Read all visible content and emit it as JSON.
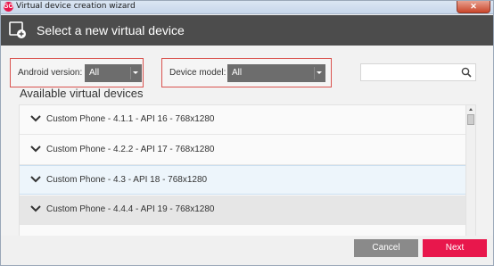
{
  "window": {
    "title": "Virtual device creation wizard",
    "close_label": "✕"
  },
  "header": {
    "title": "Select a new virtual device",
    "icon": "add-device-icon"
  },
  "filters": {
    "android": {
      "label": "Android version:",
      "selected": "All"
    },
    "device": {
      "label": "Device model:",
      "selected": "All"
    }
  },
  "search": {
    "value": "",
    "placeholder": "",
    "icon": "search-icon"
  },
  "section_title": "Available virtual devices",
  "devices": [
    {
      "label": "Custom Phone - 4.1.1 - API 16 - 768x1280"
    },
    {
      "label": "Custom Phone - 4.2.2 - API 17 - 768x1280"
    },
    {
      "label": "Custom Phone - 4.3 - API 18 - 768x1280"
    },
    {
      "label": "Custom Phone - 4.4.4 - API 19 - 768x1280"
    }
  ],
  "footer": {
    "cancel_label": "Cancel",
    "next_label": "Next"
  },
  "colors": {
    "accent": "#e8174c",
    "header_bg": "#4c4c4c",
    "filter_border": "#d9534f",
    "cancel_bg": "#8a8a8a"
  }
}
